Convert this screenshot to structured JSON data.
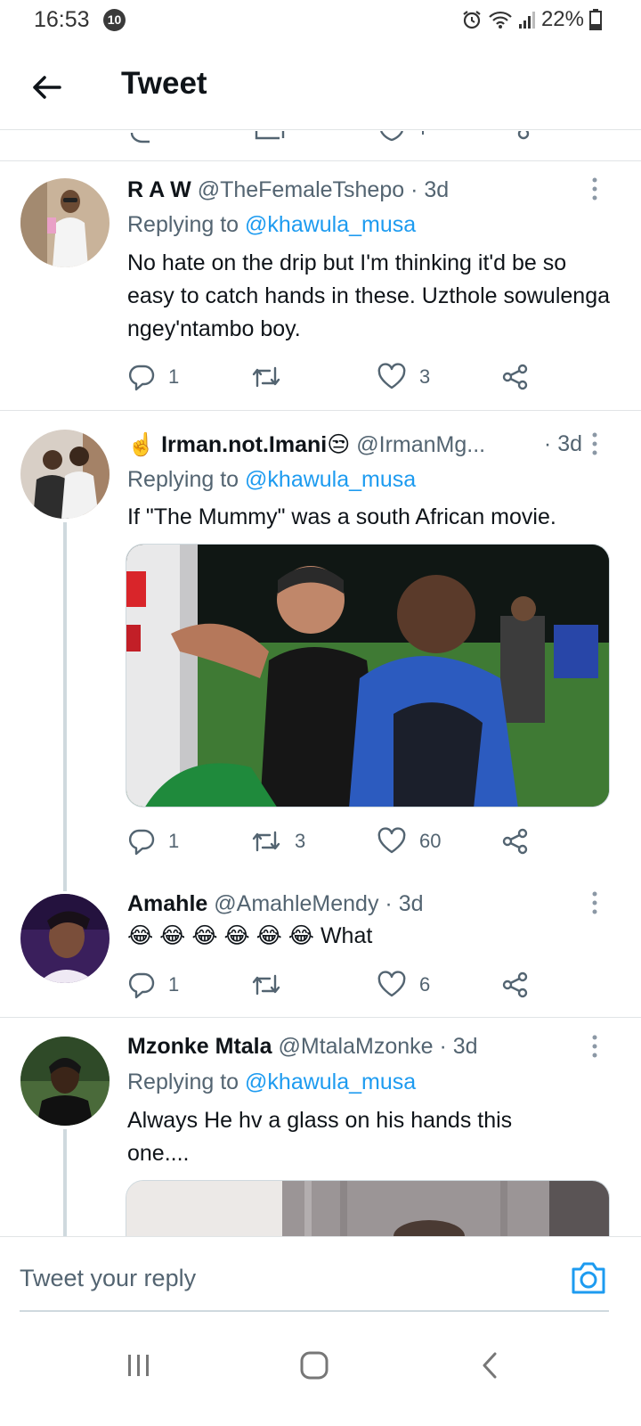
{
  "status_bar": {
    "time": "16:53",
    "notification_count": "10",
    "battery": "22%"
  },
  "header": {
    "title": "Tweet"
  },
  "tweets": [
    {
      "name": "R A W",
      "handle": "@TheFemaleTshepo",
      "time": "3d",
      "replying_label": "Replying to",
      "replying_to": "@khawula_musa",
      "text": "No hate on the drip but I'm thinking it'd be so easy to catch hands in these. Uzthole sowulenga ngey'ntambo boy.",
      "replies": "1",
      "retweets": "",
      "likes": "3"
    },
    {
      "name": "Irman.not.Imani",
      "name_prefix_emoji": "☝️",
      "name_suffix_emoji": "😒",
      "handle": "@IrmanMg...",
      "time": "3d",
      "replying_label": "Replying to",
      "replying_to": "@khawula_musa",
      "text": "If \"The Mummy\" was a south African movie.",
      "replies": "1",
      "retweets": "3",
      "likes": "60"
    },
    {
      "name": "Amahle",
      "handle": "@AmahleMendy",
      "time": "3d",
      "text": "😂 😂 😂 😂 😂 😂 What",
      "replies": "1",
      "retweets": "",
      "likes": "6"
    },
    {
      "name": "Mzonke Mtala",
      "handle": "@MtalaMzonke",
      "time": "3d",
      "replying_label": "Replying to",
      "replying_to": "@khawula_musa",
      "text": "Always He hv a glass on his hands this one...."
    }
  ],
  "reply_bar": {
    "placeholder": "Tweet your reply"
  },
  "colors": {
    "accent": "#1d9bf0",
    "text": "#0f1419",
    "secondary": "#536471",
    "border": "#e1e4e6"
  },
  "icons": [
    "back-arrow-icon",
    "reply-icon",
    "retweet-icon",
    "like-icon",
    "share-icon",
    "more-icon",
    "camera-icon",
    "recents-icon",
    "home-icon",
    "nav-back-icon"
  ]
}
